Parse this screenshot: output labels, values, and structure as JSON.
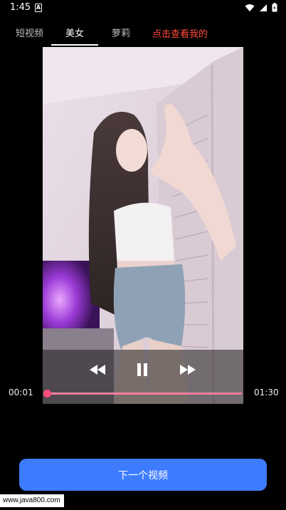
{
  "status_bar": {
    "time": "1:45",
    "notification_letter": "A"
  },
  "tabs": [
    {
      "label": "短视频",
      "active": false
    },
    {
      "label": "美女",
      "active": true
    },
    {
      "label": "萝莉",
      "active": false
    }
  ],
  "promo_link": "点击查看我的",
  "player": {
    "current_time": "00:01",
    "duration": "01:30",
    "progress_fraction": 0.01,
    "state": "playing"
  },
  "next_button_label": "下一个视频",
  "watermark": "www.java800.com",
  "colors": {
    "accent_blue": "#3d7bff",
    "promo_red": "#ff4a3d",
    "progress_pink": "#ff4d7d"
  }
}
